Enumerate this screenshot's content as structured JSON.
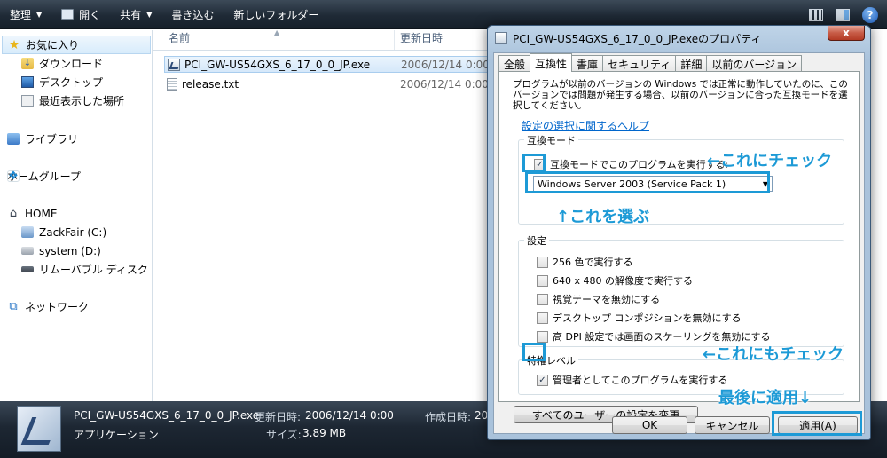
{
  "toolbar": {
    "organize": "整理",
    "open": "開く",
    "share": "共有",
    "burn": "書き込む",
    "new_folder": "新しいフォルダー"
  },
  "nav": {
    "favorites": "お気に入り",
    "downloads": "ダウンロード",
    "desktop": "デスクトップ",
    "recent": "最近表示した場所",
    "libraries": "ライブラリ",
    "homegroup": "ホームグループ",
    "home": "HOME",
    "user": "ZackFair (C:)",
    "system": "system (D:)",
    "removable": "リムーバブル ディスク",
    "network": "ネットワーク"
  },
  "files": {
    "col_name": "名前",
    "col_date": "更新日時",
    "rows": [
      {
        "name": "PCI_GW-US54GXS_6_17_0_0_JP.exe",
        "date": "2006/12/14 0:00"
      },
      {
        "name": "release.txt",
        "date": "2006/12/14 0:00"
      }
    ]
  },
  "details": {
    "filename": "PCI_GW-US54GXS_6_17_0_0_JP.exe",
    "modified_label": "更新日時:",
    "modified_value": "2006/12/14 0:00",
    "type": "アプリケーション",
    "size_label": "サイズ:",
    "size_value": "3.89 MB",
    "created_label": "作成日時:",
    "created_value": "20"
  },
  "dialog": {
    "title": "PCI_GW-US54GXS_6_17_0_0_JP.exeのプロパティ",
    "close": "x",
    "tabs": [
      "全般",
      "互換性",
      "書庫",
      "セキュリティ",
      "詳細",
      "以前のバージョン"
    ],
    "description": "プログラムが以前のバージョンの Windows では正常に動作していたのに、このバージョンでは問題が発生する場合、以前のバージョンに合った互換モードを選択してください。",
    "help_link": "設定の選択に関するヘルプ",
    "compat_group": "互換モード",
    "compat_checkbox": "互換モードでこのプログラムを実行する:",
    "compat_select": "Windows Server 2003 (Service Pack 1)",
    "settings_group": "設定",
    "settings": [
      "256 色で実行する",
      "640 x 480 の解像度で実行する",
      "視覚テーマを無効にする",
      "デスクトップ コンポジションを無効にする",
      "高 DPI 設定では画面のスケーリングを無効にする"
    ],
    "privilege_group": "特権レベル",
    "admin_checkbox": "管理者としてこのプログラムを実行する",
    "all_users_button": "すべてのユーザーの設定を変更",
    "ok": "OK",
    "cancel": "キャンセル",
    "apply": "適用(A)"
  },
  "annotations": {
    "check_this": "←これにチェック",
    "choose_this": "↑これを選ぶ",
    "check_this_too": "←これにもチェック",
    "apply_last": "最後に適用↓"
  },
  "colors": {
    "annotation": "#1d9ad6",
    "link": "#0066cc"
  }
}
